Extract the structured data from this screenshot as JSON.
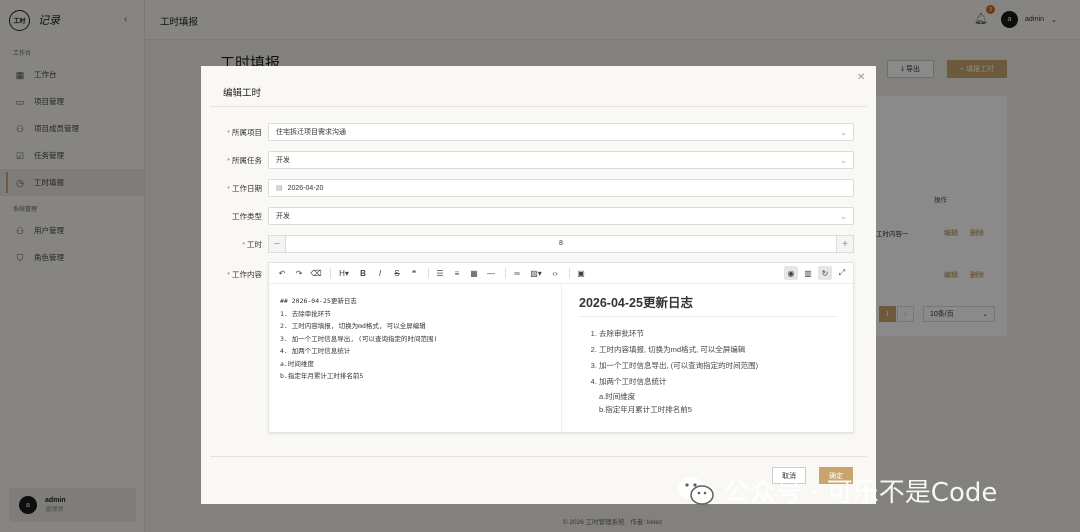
{
  "sidebar": {
    "logo_badge": "工时",
    "logo_text": "记录",
    "collapse_icon": "chevron-left-icon",
    "group1": "工作台",
    "group2": "系统管理",
    "items": [
      {
        "label": "工作台",
        "icon": "grid-icon"
      },
      {
        "label": "项目管理",
        "icon": "folder-icon"
      },
      {
        "label": "项目成员管理",
        "icon": "users-icon"
      },
      {
        "label": "任务管理",
        "icon": "checkbox-icon"
      },
      {
        "label": "工时填报",
        "icon": "clock-icon",
        "active": true
      },
      {
        "label": "用户管理",
        "icon": "user-group-icon"
      },
      {
        "label": "角色管理",
        "icon": "shield-icon"
      }
    ],
    "user": {
      "avatar": "a",
      "name": "admin",
      "role": "管理员"
    }
  },
  "topbar": {
    "title": "工时填报",
    "notification_count": "3",
    "user_avatar": "a",
    "user_name": "admin"
  },
  "page": {
    "title": "工时填报",
    "export_label": "导出",
    "new_label": "填报工时",
    "ops_header": "操作",
    "row1_text": "工时内容一",
    "edit_label": "编辑",
    "delete_label": "删除",
    "page_current": "1",
    "page_size": "10条/页"
  },
  "footer": {
    "text": "© 2026 工时管理系统 · 作者: kelez"
  },
  "modal": {
    "title": "编辑工时",
    "fields": {
      "project": {
        "label": "所属项目",
        "value": "住宅拆迁项目需求沟通"
      },
      "task": {
        "label": "所属任务",
        "value": "开发"
      },
      "date": {
        "label": "工作日期",
        "value": "2026-04-20"
      },
      "type": {
        "label": "工作类型",
        "value": "开发"
      },
      "hours": {
        "label": "工时",
        "value": "8"
      },
      "content": {
        "label": "工作内容"
      }
    },
    "editor": {
      "source_lines": [
        "## 2026-04-25更新日志",
        "1. 去除审批环节",
        "2. 工时内容填报, 切换为md格式, 可以全屏编辑",
        "3. 加一个工时信息导出, (可以查询指定的时间范围)",
        "4. 加两个工时信息统计",
        "a.时间维度",
        "b.指定年月累计工时排名前5"
      ],
      "preview_title": "2026-04-25更新日志",
      "preview_items": [
        "去除审批环节",
        "工时内容填报, 切换为md格式, 可以全屏编辑",
        "加一个工时信息导出, (可以查询指定的时间范围)",
        "加两个工时信息统计"
      ],
      "preview_sub": [
        "a.时间维度",
        "b.指定年月累计工时排名前5"
      ]
    },
    "cancel_label": "取消",
    "ok_label": "确定"
  },
  "watermark": {
    "text": "公众号 · 可乐不是Code"
  }
}
